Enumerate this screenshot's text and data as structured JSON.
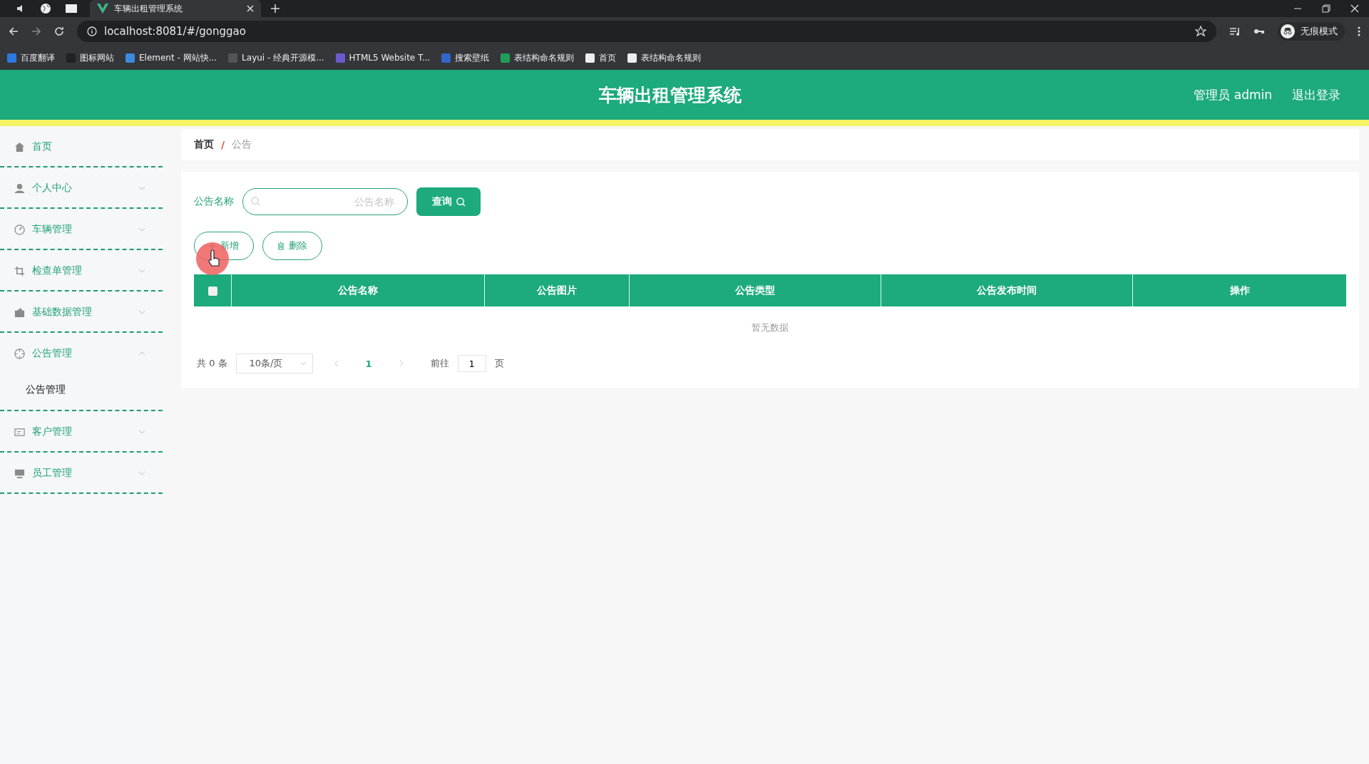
{
  "browser": {
    "tab_title": "车辆出租管理系统",
    "url": "localhost:8081/#/gonggao",
    "profile": "无痕模式",
    "bookmarks": [
      "百度翻译",
      "图标网站",
      "Element - 网站快...",
      "Layui - 经典开源模...",
      "HTML5 Website T...",
      "搜索壁纸",
      "表结构命名规则",
      "首页",
      "表结构命名规则"
    ]
  },
  "header": {
    "title": "车辆出租管理系统",
    "user": "管理员 admin",
    "logout": "退出登录"
  },
  "sidebar": {
    "items": [
      {
        "label": "首页"
      },
      {
        "label": "个人中心",
        "expanded": false
      },
      {
        "label": "车辆管理",
        "expanded": false
      },
      {
        "label": "检查单管理",
        "expanded": false
      },
      {
        "label": "基础数据管理",
        "expanded": false
      },
      {
        "label": "公告管理",
        "expanded": true,
        "children": [
          {
            "label": "公告管理"
          }
        ]
      },
      {
        "label": "客户管理",
        "expanded": false
      },
      {
        "label": "员工管理",
        "expanded": false
      }
    ]
  },
  "breadcrumb": {
    "separator": "/",
    "items": [
      "首页",
      "公告"
    ]
  },
  "search": {
    "label": "公告名称",
    "placeholder": "公告名称",
    "button": "查询"
  },
  "actions": [
    "新增",
    "删除"
  ],
  "table": {
    "select_all_checked": false,
    "columns": [
      "公告名称",
      "公告图片",
      "公告类型",
      "公告发布时间",
      "操作"
    ],
    "empty_text": "暂无数据"
  },
  "pagination": {
    "total": "共 0 条",
    "page_size": "10条/页",
    "current_page": "1",
    "goto_label": "前往",
    "goto_value": "1",
    "page_unit": "页"
  }
}
